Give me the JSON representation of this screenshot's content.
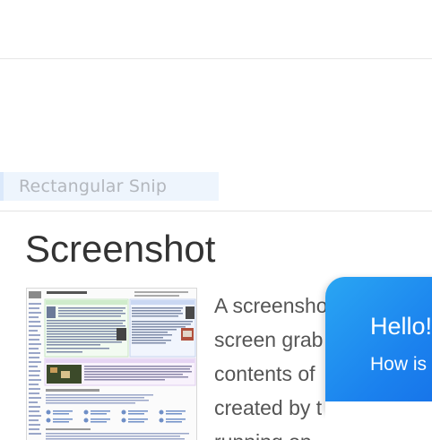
{
  "tooltip": {
    "label": "Rectangular Snip"
  },
  "article": {
    "title": "Screenshot",
    "body_lines": [
      "A screensho",
      "screen grab",
      "contents of",
      "created by t",
      "running on"
    ]
  },
  "chat": {
    "greeting": "Hello!",
    "subtext": "How is"
  },
  "colors": {
    "chat_accent": "#1b82ee",
    "tooltip_bg": "#eef5fd"
  }
}
